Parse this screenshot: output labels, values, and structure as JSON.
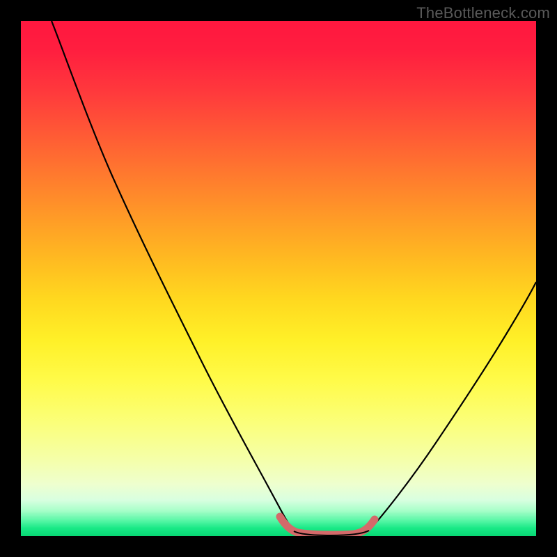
{
  "watermark": "TheBottleneck.com",
  "colors": {
    "frame_bg": "#000000",
    "curve_stroke": "#000000",
    "highlight_stroke": "#d46a6a",
    "gradient_top": "#ff173f",
    "gradient_mid": "#fff028",
    "gradient_bottom": "#07d873"
  },
  "chart_data": {
    "type": "line",
    "title": "",
    "xlabel": "",
    "ylabel": "",
    "xlim": [
      0,
      100
    ],
    "ylim": [
      0,
      100
    ],
    "series": [
      {
        "name": "left-curve",
        "x": [
          6,
          10,
          15,
          20,
          25,
          30,
          35,
          40,
          45,
          48,
          50,
          52
        ],
        "y": [
          100,
          92,
          82,
          72,
          62,
          51,
          40,
          29,
          17,
          9,
          4,
          1
        ]
      },
      {
        "name": "bottleneck-minimum-highlight",
        "x": [
          50,
          52,
          54,
          57,
          60,
          63,
          66,
          68
        ],
        "y": [
          4,
          1.5,
          0.8,
          0.6,
          0.6,
          0.8,
          1.5,
          4
        ]
      },
      {
        "name": "right-curve",
        "x": [
          66,
          70,
          75,
          80,
          85,
          90,
          95,
          100
        ],
        "y": [
          1,
          5,
          12,
          20,
          28,
          36,
          45,
          53
        ]
      }
    ],
    "background_gradient_stops": [
      {
        "pos": 0,
        "color": "#ff173f"
      },
      {
        "pos": 50,
        "color": "#ffd81f"
      },
      {
        "pos": 90,
        "color": "#eeffcf"
      },
      {
        "pos": 100,
        "color": "#07d873"
      }
    ]
  }
}
